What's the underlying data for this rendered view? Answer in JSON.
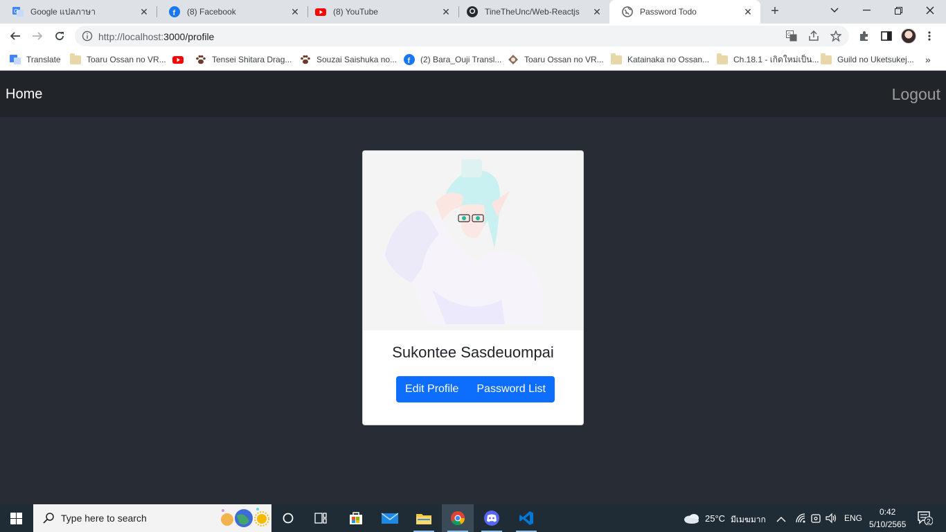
{
  "browser": {
    "tabs": [
      {
        "title": "Google แปลภาษา",
        "icon": "google-translate-icon"
      },
      {
        "title": "(8) Facebook",
        "icon": "facebook-icon"
      },
      {
        "title": "(8) YouTube",
        "icon": "youtube-icon"
      },
      {
        "title": "TineTheUnc/Web-Reactjs",
        "icon": "github-icon"
      },
      {
        "title": "Password Todo",
        "icon": "globe-icon",
        "active": true
      }
    ],
    "url_host": "http://localhost:",
    "url_path": "3000/profile",
    "bookmarks": [
      {
        "label": "Translate",
        "icon": "google-translate-icon"
      },
      {
        "label": "Toaru Ossan no VR...",
        "icon": "folder-icon"
      },
      {
        "label": "",
        "icon": "youtube-icon"
      },
      {
        "label": "Tensei Shitara Drag...",
        "icon": "paw-icon"
      },
      {
        "label": "Souzai Saishuka no...",
        "icon": "paw-icon"
      },
      {
        "label": "(2) Bara_Ouji Transl...",
        "icon": "facebook-icon"
      },
      {
        "label": "Toaru Ossan no VR...",
        "icon": "site-icon"
      },
      {
        "label": "Katainaka no Ossan...",
        "icon": "folder-icon"
      },
      {
        "label": "Ch.18.1 - เกิดใหม่เป็น...",
        "icon": "folder-icon"
      },
      {
        "label": "Guild no Uketsukej...",
        "icon": "folder-icon"
      }
    ]
  },
  "navbar": {
    "home_label": "Home",
    "logout_label": "Logout"
  },
  "profile": {
    "name": "Sukontee Sasdeuompai",
    "edit_label": "Edit Profile",
    "password_list_label": "Password List"
  },
  "taskbar": {
    "search_placeholder": "Type here to search",
    "weather_temp": "25°C",
    "weather_desc": "มีเมฆมาก",
    "language": "ENG",
    "time": "0:42",
    "date": "5/10/2565",
    "notifications": "2"
  },
  "colors": {
    "app_bg": "#282c34",
    "navbar_bg": "#212529",
    "primary_button": "#0d6efd"
  }
}
